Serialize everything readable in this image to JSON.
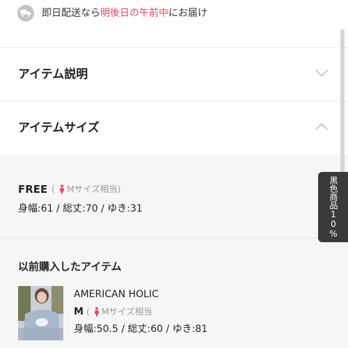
{
  "delivery": {
    "icon": "truck-icon",
    "prefix": "即日配送なら",
    "highlight": "明後日の午前中",
    "suffix": "にお届け"
  },
  "accordion": {
    "description": {
      "title": "アイテム説明",
      "icon": "chevron-down-icon",
      "expanded": false
    },
    "size": {
      "title": "アイテムサイズ",
      "icon": "chevron-up-icon",
      "expanded": true
    }
  },
  "size_detail": {
    "name": "FREE",
    "equiv_open": "(",
    "equiv": "Mサイズ相当)",
    "measurements": "身幅:61 / 総丈:70 / ゆき:31"
  },
  "previous": {
    "title": "以前購入したアイテム",
    "brand": "AMERICAN HOLIC",
    "size": "M",
    "equiv_open": "(",
    "equiv": "Mサイズ相当",
    "measurements": "身幅:50.5 / 総丈:60 / ゆき:81"
  },
  "side_tab": {
    "label": "黒色商品10%"
  },
  "colors": {
    "highlight": "#e8475f",
    "person_icon": "#e8475f",
    "side_tab_bg": "#3a3a3a",
    "panel_bg": "#f6f6f6"
  }
}
